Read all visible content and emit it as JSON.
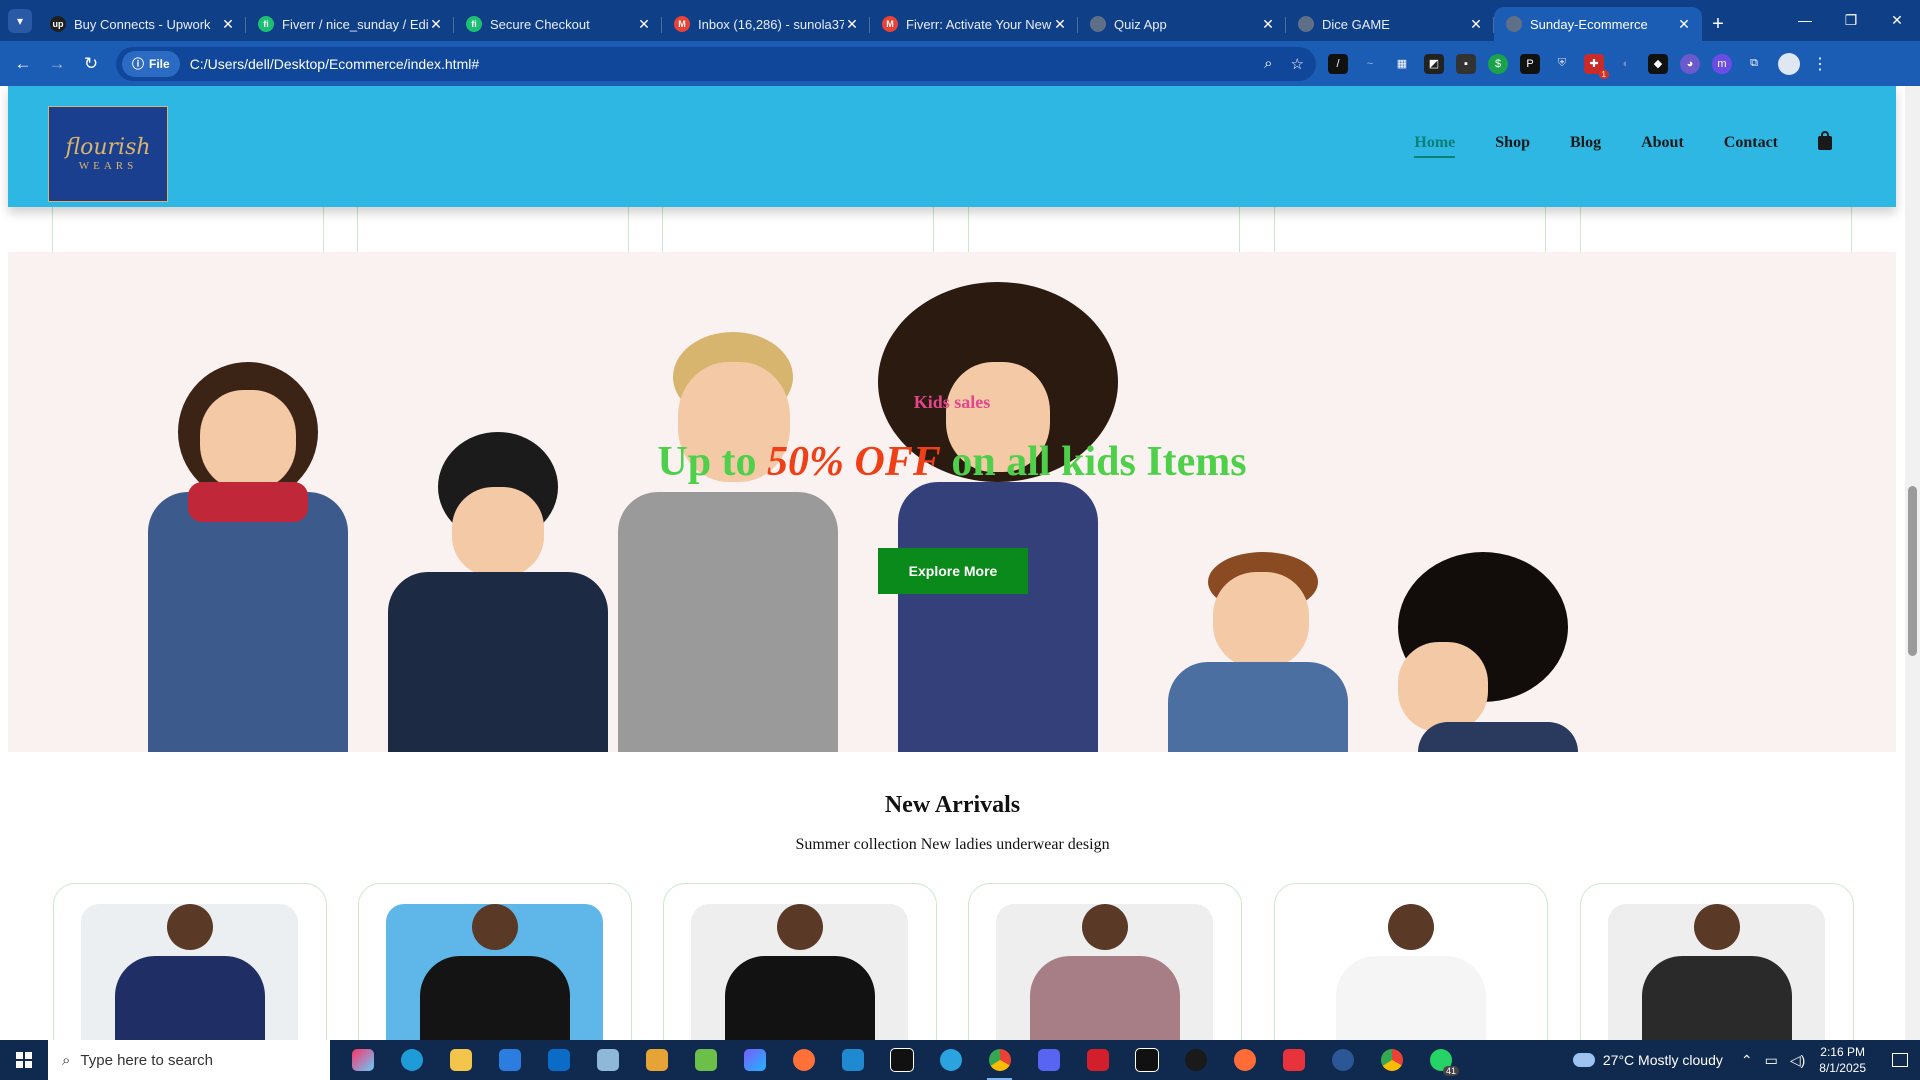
{
  "browser": {
    "tabs": [
      {
        "title": "Buy Connects - Upwork",
        "icon": "upwork-icon",
        "color": "#1f1f1f",
        "glyph": "up"
      },
      {
        "title": "Fiverr / nice_sunday / Edit",
        "icon": "fiverr-icon",
        "color": "#1dbf73",
        "glyph": "fi"
      },
      {
        "title": "Secure Checkout",
        "icon": "fiverr-icon",
        "color": "#1dbf73",
        "glyph": "fi"
      },
      {
        "title": "Inbox (16,286) - sunola37",
        "icon": "gmail-icon",
        "color": "#ea4335",
        "glyph": "M"
      },
      {
        "title": "Fiverr: Activate Your New",
        "icon": "gmail-icon",
        "color": "#ea4335",
        "glyph": "M"
      },
      {
        "title": "Quiz App",
        "icon": "globe-icon",
        "color": "#5f6f88",
        "glyph": ""
      },
      {
        "title": "Dice GAME",
        "icon": "globe-icon",
        "color": "#5f6f88",
        "glyph": ""
      },
      {
        "title": "Sunday-Ecommerce",
        "icon": "globe-icon",
        "color": "#5f6f88",
        "glyph": ""
      }
    ],
    "active_tab": 7,
    "address": {
      "scheme_label": "File",
      "url": "C:/Users/dell/Desktop/Ecommerce/index.html#"
    },
    "extension_badge": "1"
  },
  "site": {
    "logo": {
      "script": "flourish",
      "sub": "WEARS"
    },
    "nav": [
      "Home",
      "Shop",
      "Blog",
      "About",
      "Contact"
    ],
    "nav_active": "Home",
    "accent": "#088178",
    "header_bg": "#2fb7e4"
  },
  "banner": {
    "label": "Kids sales",
    "headline_prefix": "Up to ",
    "headline_highlight": "50% OFF",
    "headline_suffix": " on all kids Items",
    "button": "Explore More",
    "colors": {
      "label": "#e4458d",
      "headline": "#4ed04a",
      "highlight": "#ef3f17",
      "button": "#0a8a1a"
    }
  },
  "new_arrivals": {
    "title": "New Arrivals",
    "subtitle": "Summer collection New ladies underwear design",
    "products": [
      {
        "image": "navy-adidas-tee",
        "bg": "#eceff1",
        "color": "#1f2f66"
      },
      {
        "image": "black-tracksuit-model",
        "bg": "#5fb6e8",
        "color": "#141414"
      },
      {
        "image": "black-hoodie",
        "bg": "#eeeeee",
        "color": "#121212"
      },
      {
        "image": "mauve-sweatshirt",
        "bg": "#eeeeee",
        "color": "#a77e86"
      },
      {
        "image": "nike-white-crop-tee",
        "bg": "#ffffff",
        "color": "#f5f5f5"
      },
      {
        "image": "black-tank-top",
        "bg": "#eeeeee",
        "color": "#2a2a2a"
      }
    ]
  },
  "taskbar": {
    "search_placeholder": "Type here to search",
    "weather": "27°C  Mostly cloudy",
    "time": "2:16 PM",
    "date": "8/1/2025",
    "whatsapp_badge": "41"
  }
}
